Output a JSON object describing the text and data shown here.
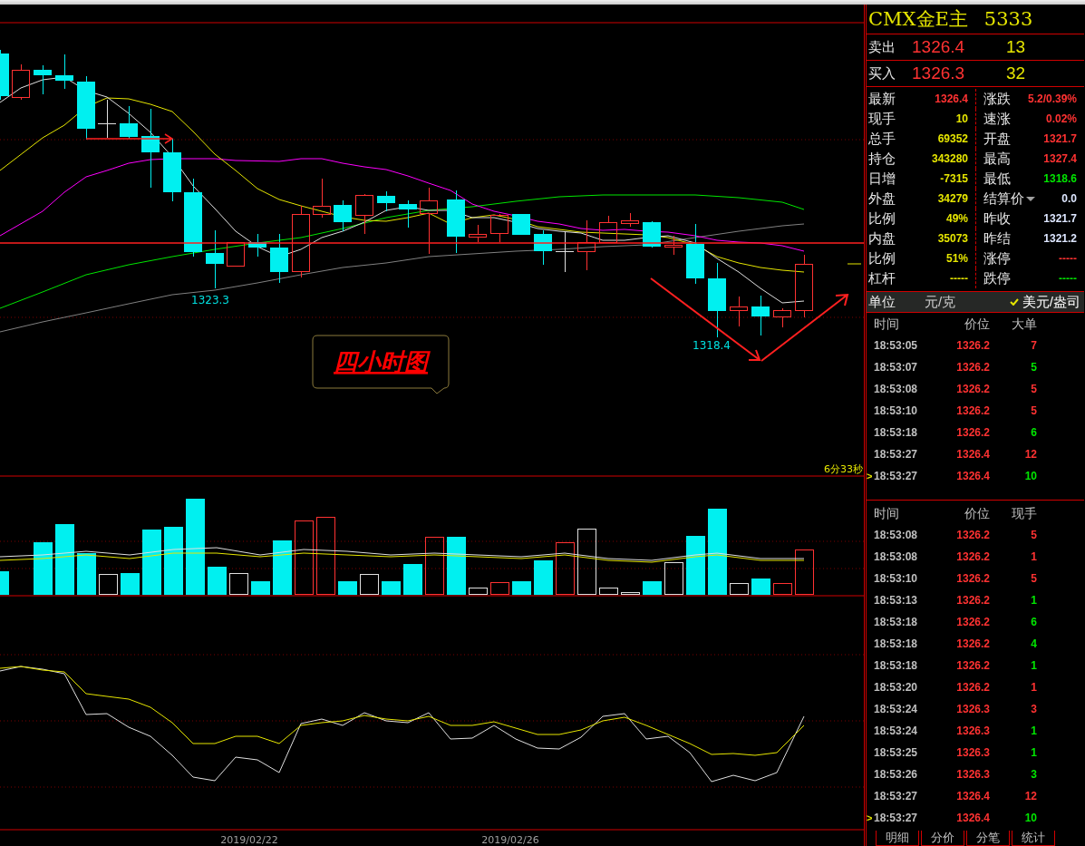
{
  "chart": {
    "price_labels": [
      "1323.3",
      "1318.4"
    ],
    "callout": "四小时图",
    "countdown": "6分33秒",
    "dates": [
      "2019/02/22",
      "2019/02/26"
    ]
  },
  "instrument": {
    "name": "CMX金E主",
    "code": "5333"
  },
  "quotes": [
    {
      "label": "卖出",
      "price": "1326.4",
      "volume": "13"
    },
    {
      "label": "买入",
      "price": "1326.3",
      "volume": "32"
    }
  ],
  "stats": [
    {
      "left": {
        "label": "最新",
        "value": "1326.4",
        "color": "#ff3232",
        "kind": "plain"
      },
      "right": {
        "label": "涨跌",
        "value": "5.2/0.39%",
        "color": "#ff3232",
        "kind": "plain"
      }
    },
    {
      "left": {
        "label": "现手",
        "value": "10",
        "color": "#e6e600",
        "kind": "plain"
      },
      "right": {
        "label": "速涨",
        "value": "0.02%",
        "color": "#ff3232",
        "kind": "plain"
      }
    },
    {
      "left": {
        "label": "总手",
        "value": "69352",
        "color": "#e6e600",
        "kind": "plain"
      },
      "right": {
        "label": "开盘",
        "value": "1321.7",
        "color": "#ff3232",
        "kind": "plain"
      }
    },
    {
      "left": {
        "label": "持仓",
        "value": "343280",
        "color": "#e6e600",
        "kind": "plain"
      },
      "right": {
        "label": "最高",
        "value": "1327.4",
        "color": "#ff3232",
        "kind": "plain"
      }
    },
    {
      "left": {
        "label": "日增",
        "value": "-7315",
        "color": "#e6e600",
        "kind": "plain"
      },
      "right": {
        "label": "最低",
        "value": "1318.6",
        "color": "#00e600",
        "kind": "plain"
      }
    },
    {
      "left": {
        "label": "外盘",
        "value": "34279",
        "color": "#e6e600",
        "kind": "plain"
      },
      "right": {
        "label": "结算价",
        "value": "0.0",
        "color": "#dde6ff",
        "kind": "dropdown"
      }
    },
    {
      "left": {
        "label": "比例",
        "value": "49%",
        "color": "#e6e600",
        "kind": "plain"
      },
      "right": {
        "label": "昨收",
        "value": "1321.7",
        "color": "#dde6ff",
        "kind": "plain"
      }
    },
    {
      "left": {
        "label": "内盘",
        "value": "35073",
        "color": "#e6e600",
        "kind": "plain"
      },
      "right": {
        "label": "昨结",
        "value": "1321.2",
        "color": "#dde6ff",
        "kind": "plain"
      }
    },
    {
      "left": {
        "label": "比例",
        "value": "51%",
        "color": "#e6e600",
        "kind": "plain"
      },
      "right": {
        "label": "涨停",
        "value": "-----",
        "color": "#ff3232",
        "kind": "plain"
      }
    },
    {
      "left": {
        "label": "杠杆",
        "value": "-----",
        "color": "#e6e600",
        "kind": "plain"
      },
      "right": {
        "label": "跌停",
        "value": "-----",
        "color": "#00e600",
        "kind": "plain"
      }
    }
  ],
  "unit": {
    "label": "单位",
    "options": [
      {
        "label": "元/克",
        "selected": false
      },
      {
        "label": "美元/盎司",
        "selected": true
      }
    ]
  },
  "large_orders": {
    "columns": [
      "时间",
      "价位",
      "大单"
    ],
    "rows": [
      {
        "time": "18:53:05",
        "price": "1326.2",
        "volume": "7",
        "color": "#ff3232"
      },
      {
        "time": "18:53:07",
        "price": "1326.2",
        "volume": "5",
        "color": "#00e600"
      },
      {
        "time": "18:53:08",
        "price": "1326.2",
        "volume": "5",
        "color": "#ff3232"
      },
      {
        "time": "18:53:10",
        "price": "1326.2",
        "volume": "5",
        "color": "#ff3232"
      },
      {
        "time": "18:53:18",
        "price": "1326.2",
        "volume": "6",
        "color": "#00e600"
      },
      {
        "time": "18:53:27",
        "price": "1326.4",
        "volume": "12",
        "color": "#ff3232"
      },
      {
        "time": "18:53:27",
        "price": "1326.4",
        "volume": "10",
        "color": "#00e600",
        "marker": ">"
      }
    ]
  },
  "ticks": {
    "columns": [
      "时间",
      "价位",
      "现手"
    ],
    "rows": [
      {
        "time": "18:53:08",
        "price": "1326.2",
        "volume": "5",
        "color": "#ff3232"
      },
      {
        "time": "18:53:08",
        "price": "1326.2",
        "volume": "1",
        "color": "#ff3232"
      },
      {
        "time": "18:53:10",
        "price": "1326.2",
        "volume": "5",
        "color": "#ff3232"
      },
      {
        "time": "18:53:13",
        "price": "1326.2",
        "volume": "1",
        "color": "#00e600"
      },
      {
        "time": "18:53:18",
        "price": "1326.2",
        "volume": "6",
        "color": "#00e600"
      },
      {
        "time": "18:53:18",
        "price": "1326.2",
        "volume": "4",
        "color": "#00e600"
      },
      {
        "time": "18:53:18",
        "price": "1326.2",
        "volume": "1",
        "color": "#00e600"
      },
      {
        "time": "18:53:20",
        "price": "1326.2",
        "volume": "1",
        "color": "#ff3232"
      },
      {
        "time": "18:53:24",
        "price": "1326.3",
        "volume": "3",
        "color": "#ff3232"
      },
      {
        "time": "18:53:24",
        "price": "1326.3",
        "volume": "1",
        "color": "#00e600"
      },
      {
        "time": "18:53:25",
        "price": "1326.3",
        "volume": "1",
        "color": "#00e600"
      },
      {
        "time": "18:53:26",
        "price": "1326.3",
        "volume": "3",
        "color": "#00e600"
      },
      {
        "time": "18:53:27",
        "price": "1326.4",
        "volume": "12",
        "color": "#ff3232"
      },
      {
        "time": "18:53:27",
        "price": "1326.4",
        "volume": "10",
        "color": "#00e600",
        "marker": ">"
      }
    ]
  },
  "tabs": [
    {
      "label": "明细"
    },
    {
      "label": "分价"
    },
    {
      "label": "分笔"
    },
    {
      "label": "统计"
    }
  ]
}
